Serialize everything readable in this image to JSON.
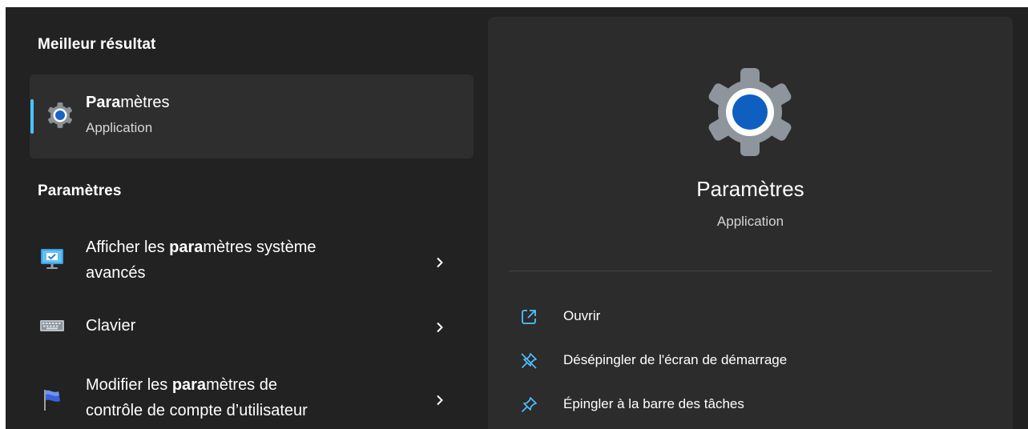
{
  "left": {
    "best_header": "Meilleur résultat",
    "best": {
      "title_bold": "Para",
      "title_rest": "mètres",
      "subtitle": "Application",
      "icon": "settings-gear-icon"
    },
    "settings_header": "Paramètres",
    "results": [
      {
        "icon": "monitor-settings-icon",
        "line1_pre": "Afficher les ",
        "line1_bold": "para",
        "line1_post": "mètres système",
        "line2": "avancés"
      },
      {
        "icon": "keyboard-icon",
        "line1_pre": "Clavier",
        "line1_bold": "",
        "line1_post": "",
        "line2": ""
      },
      {
        "icon": "uac-flag-icon",
        "line1_pre": "Modifier les ",
        "line1_bold": "para",
        "line1_post": "mètres de",
        "line2": "contrôle de compte d’utilisateur"
      }
    ]
  },
  "right": {
    "title": "Paramètres",
    "subtitle": "Application",
    "actions": [
      {
        "icon": "open-external-icon",
        "label": "Ouvrir"
      },
      {
        "icon": "unpin-icon",
        "label": "Désépingler de l'écran de démarrage"
      },
      {
        "icon": "pin-icon",
        "label": "Épingler à la barre des tâches"
      }
    ]
  },
  "colors": {
    "background": "#222222",
    "panel": "#2c2c2c",
    "selected": "#2e2e2e",
    "accent": "#4cc2ff",
    "gear_blue": "#0f5fc0"
  }
}
